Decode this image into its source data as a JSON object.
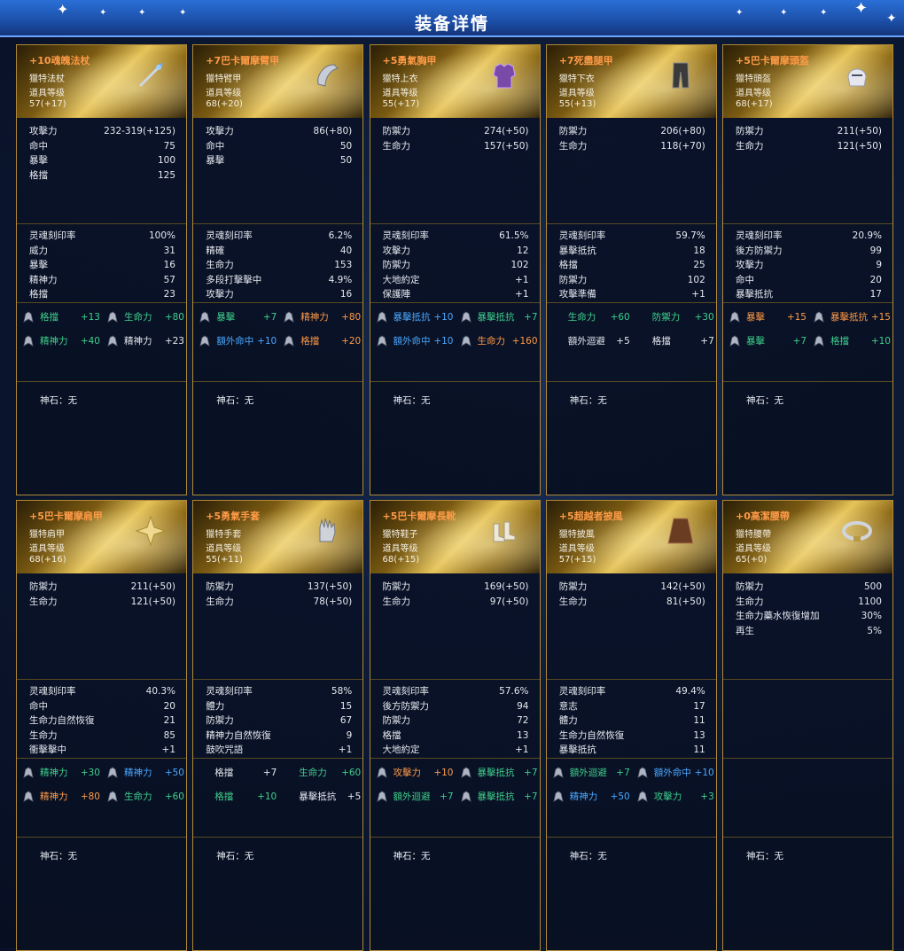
{
  "title": "装备详情",
  "colors": {
    "gold": "#ff9b48",
    "green": "#3fd08c",
    "orange": "#ff9b48",
    "blue": "#4aa8ff",
    "white": "#e6e9f0"
  },
  "labels": {
    "shen_shi": "神石：无"
  },
  "cards": [
    {
      "name": "+10魂魄法杖",
      "type": "獵特法杖",
      "lvl_label": "道具等级",
      "lvl": "57(+17)",
      "icon": "staff-icon",
      "base": [
        [
          "攻擊力",
          "232-319(+125)"
        ],
        [
          "命中",
          "75"
        ],
        [
          "暴擊",
          "100"
        ],
        [
          "格擋",
          "125"
        ]
      ],
      "soul": [
        [
          "灵魂刻印率",
          "100%"
        ],
        [
          "威力",
          "31"
        ],
        [
          "暴擊",
          "16"
        ],
        [
          "精神力",
          "57"
        ],
        [
          "格擋",
          "23"
        ]
      ],
      "gems": [
        {
          "k": "格擋",
          "v": "+13",
          "kc": "green",
          "vc": "green"
        },
        {
          "k": "生命力",
          "v": "+80",
          "kc": "green",
          "vc": "green"
        },
        {
          "k": "精神力",
          "v": "+40",
          "kc": "green",
          "vc": "green"
        },
        {
          "k": "精神力",
          "v": "+23",
          "kc": "white",
          "vc": "white"
        }
      ]
    },
    {
      "name": "+7巴卡爾摩臂甲",
      "type": "獵特臂甲",
      "lvl_label": "道具等级",
      "lvl": "68(+20)",
      "icon": "bracer-icon",
      "base": [
        [
          "攻擊力",
          "86(+80)"
        ],
        [
          "命中",
          "50"
        ],
        [
          "暴擊",
          "50"
        ]
      ],
      "soul": [
        [
          "灵魂刻印率",
          "6.2%"
        ],
        [
          "精確",
          "40"
        ],
        [
          "生命力",
          "153"
        ],
        [
          "多段打擊擊中",
          "4.9%"
        ],
        [
          "攻擊力",
          "16"
        ]
      ],
      "gems": [
        {
          "k": "暴擊",
          "v": "+7",
          "kc": "green",
          "vc": "green"
        },
        {
          "k": "精神力",
          "v": "+80",
          "kc": "orange",
          "vc": "orange"
        },
        {
          "k": "額外命中",
          "v": "+10",
          "kc": "blue",
          "vc": "blue"
        },
        {
          "k": "格擋",
          "v": "+20",
          "kc": "orange",
          "vc": "orange"
        }
      ]
    },
    {
      "name": "+5勇氣胸甲",
      "type": "獵特上衣",
      "lvl_label": "道具等级",
      "lvl": "55(+17)",
      "icon": "chest-armor-icon",
      "base": [
        [
          "防禦力",
          "274(+50)"
        ],
        [
          "生命力",
          "157(+50)"
        ]
      ],
      "soul": [
        [
          "灵魂刻印率",
          "61.5%"
        ],
        [
          "攻擊力",
          "12"
        ],
        [
          "防禦力",
          "102"
        ],
        [
          "大地約定",
          "+1"
        ],
        [
          "保護陣",
          "+1"
        ]
      ],
      "gems": [
        {
          "k": "暴擊抵抗",
          "v": "+10",
          "kc": "blue",
          "vc": "blue"
        },
        {
          "k": "暴擊抵抗",
          "v": "+7",
          "kc": "green",
          "vc": "green"
        },
        {
          "k": "額外命中",
          "v": "+10",
          "kc": "blue",
          "vc": "blue"
        },
        {
          "k": "生命力",
          "v": "+160",
          "kc": "orange",
          "vc": "orange"
        }
      ]
    },
    {
      "name": "+7死盡腿甲",
      "type": "獵特下衣",
      "lvl_label": "道具等级",
      "lvl": "55(+13)",
      "icon": "leg-armor-icon",
      "base": [
        [
          "防禦力",
          "206(+80)"
        ],
        [
          "生命力",
          "118(+70)"
        ]
      ],
      "soul": [
        [
          "灵魂刻印率",
          "59.7%"
        ],
        [
          "暴擊抵抗",
          "18"
        ],
        [
          "格擋",
          "25"
        ],
        [
          "防禦力",
          "102"
        ],
        [
          "攻擊準備",
          "+1"
        ]
      ],
      "gems": [
        {
          "k": "生命力",
          "v": "+60",
          "kc": "green",
          "vc": "green",
          "noicon": true
        },
        {
          "k": "防禦力",
          "v": "+30",
          "kc": "green",
          "vc": "green",
          "noicon": true
        },
        {
          "k": "額外迴避",
          "v": "+5",
          "kc": "white",
          "vc": "white",
          "noicon": true
        },
        {
          "k": "格擋",
          "v": "+7",
          "kc": "white",
          "vc": "white",
          "noicon": true
        }
      ]
    },
    {
      "name": "+5巴卡爾摩頭盔",
      "type": "獵特頭盔",
      "lvl_label": "道具等级",
      "lvl": "68(+17)",
      "icon": "helmet-icon",
      "base": [
        [
          "防禦力",
          "211(+50)"
        ],
        [
          "生命力",
          "121(+50)"
        ]
      ],
      "soul": [
        [
          "灵魂刻印率",
          "20.9%"
        ],
        [
          "後方防禦力",
          "99"
        ],
        [
          "攻擊力",
          "9"
        ],
        [
          "命中",
          "20"
        ],
        [
          "暴擊抵抗",
          "17"
        ]
      ],
      "gems": [
        {
          "k": "暴擊",
          "v": "+15",
          "kc": "orange",
          "vc": "orange"
        },
        {
          "k": "暴擊抵抗",
          "v": "+15",
          "kc": "orange",
          "vc": "orange"
        },
        {
          "k": "暴擊",
          "v": "+7",
          "kc": "green",
          "vc": "green"
        },
        {
          "k": "格擋",
          "v": "+10",
          "kc": "green",
          "vc": "green"
        }
      ]
    },
    {
      "name": "+5巴卡爾摩肩甲",
      "type": "獵特肩甲",
      "lvl_label": "道具等级",
      "lvl": "68(+16)",
      "icon": "pauldron-icon",
      "base": [
        [
          "防禦力",
          "211(+50)"
        ],
        [
          "生命力",
          "121(+50)"
        ]
      ],
      "soul": [
        [
          "灵魂刻印率",
          "40.3%"
        ],
        [
          "命中",
          "20"
        ],
        [
          "生命力自然恢復",
          "21"
        ],
        [
          "生命力",
          "85"
        ],
        [
          "衝擊擊中",
          "+1"
        ]
      ],
      "gems": [
        {
          "k": "精神力",
          "v": "+30",
          "kc": "green",
          "vc": "green"
        },
        {
          "k": "精神力",
          "v": "+50",
          "kc": "blue",
          "vc": "blue"
        },
        {
          "k": "精神力",
          "v": "+80",
          "kc": "orange",
          "vc": "orange"
        },
        {
          "k": "生命力",
          "v": "+60",
          "kc": "green",
          "vc": "green"
        }
      ]
    },
    {
      "name": "+5勇氣手套",
      "type": "獵特手套",
      "lvl_label": "道具等级",
      "lvl": "55(+11)",
      "icon": "glove-icon",
      "base": [
        [
          "防禦力",
          "137(+50)"
        ],
        [
          "生命力",
          "78(+50)"
        ]
      ],
      "soul": [
        [
          "灵魂刻印率",
          "58%"
        ],
        [
          "體力",
          "15"
        ],
        [
          "防禦力",
          "67"
        ],
        [
          "精神力自然恢復",
          "9"
        ],
        [
          "鼓吹咒語",
          "+1"
        ]
      ],
      "gems": [
        {
          "k": "格擋",
          "v": "+7",
          "kc": "white",
          "vc": "white",
          "noicon": true
        },
        {
          "k": "生命力",
          "v": "+60",
          "kc": "green",
          "vc": "green",
          "noicon": true
        },
        {
          "k": "格擋",
          "v": "+10",
          "kc": "green",
          "vc": "green",
          "noicon": true
        },
        {
          "k": "暴擊抵抗",
          "v": "+5",
          "kc": "white",
          "vc": "white",
          "noicon": true
        }
      ]
    },
    {
      "name": "+5巴卡爾摩長靴",
      "type": "獵特鞋子",
      "lvl_label": "道具等级",
      "lvl": "68(+15)",
      "icon": "boots-icon",
      "base": [
        [
          "防禦力",
          "169(+50)"
        ],
        [
          "生命力",
          "97(+50)"
        ]
      ],
      "soul": [
        [
          "灵魂刻印率",
          "57.6%"
        ],
        [
          "後方防禦力",
          "94"
        ],
        [
          "防禦力",
          "72"
        ],
        [
          "格擋",
          "13"
        ],
        [
          "大地約定",
          "+1"
        ]
      ],
      "gems": [
        {
          "k": "攻擊力",
          "v": "+10",
          "kc": "orange",
          "vc": "orange"
        },
        {
          "k": "暴擊抵抗",
          "v": "+7",
          "kc": "green",
          "vc": "green"
        },
        {
          "k": "額外迴避",
          "v": "+7",
          "kc": "green",
          "vc": "green"
        },
        {
          "k": "暴擊抵抗",
          "v": "+7",
          "kc": "green",
          "vc": "green"
        }
      ]
    },
    {
      "name": "+5超越者披風",
      "type": "獵特披風",
      "lvl_label": "道具等级",
      "lvl": "57(+15)",
      "icon": "cloak-icon",
      "base": [
        [
          "防禦力",
          "142(+50)"
        ],
        [
          "生命力",
          "81(+50)"
        ]
      ],
      "soul": [
        [
          "灵魂刻印率",
          "49.4%"
        ],
        [
          "意志",
          "17"
        ],
        [
          "體力",
          "11"
        ],
        [
          "生命力自然恢復",
          "13"
        ],
        [
          "暴擊抵抗",
          "11"
        ]
      ],
      "gems": [
        {
          "k": "額外迴避",
          "v": "+7",
          "kc": "green",
          "vc": "green"
        },
        {
          "k": "額外命中",
          "v": "+10",
          "kc": "blue",
          "vc": "blue"
        },
        {
          "k": "精神力",
          "v": "+50",
          "kc": "blue",
          "vc": "blue"
        },
        {
          "k": "攻擊力",
          "v": "+3",
          "kc": "green",
          "vc": "green"
        }
      ]
    },
    {
      "name": "+0高潔腰帶",
      "type": "獵特腰帶",
      "lvl_label": "道具等级",
      "lvl": "65(+0)",
      "icon": "belt-icon",
      "base": [
        [
          "防禦力",
          "500"
        ],
        [
          "生命力",
          "1100"
        ],
        [
          "生命力藥水恢復增加",
          "30%"
        ],
        [
          "再生",
          "5%"
        ]
      ],
      "soul": [],
      "gems": []
    }
  ]
}
